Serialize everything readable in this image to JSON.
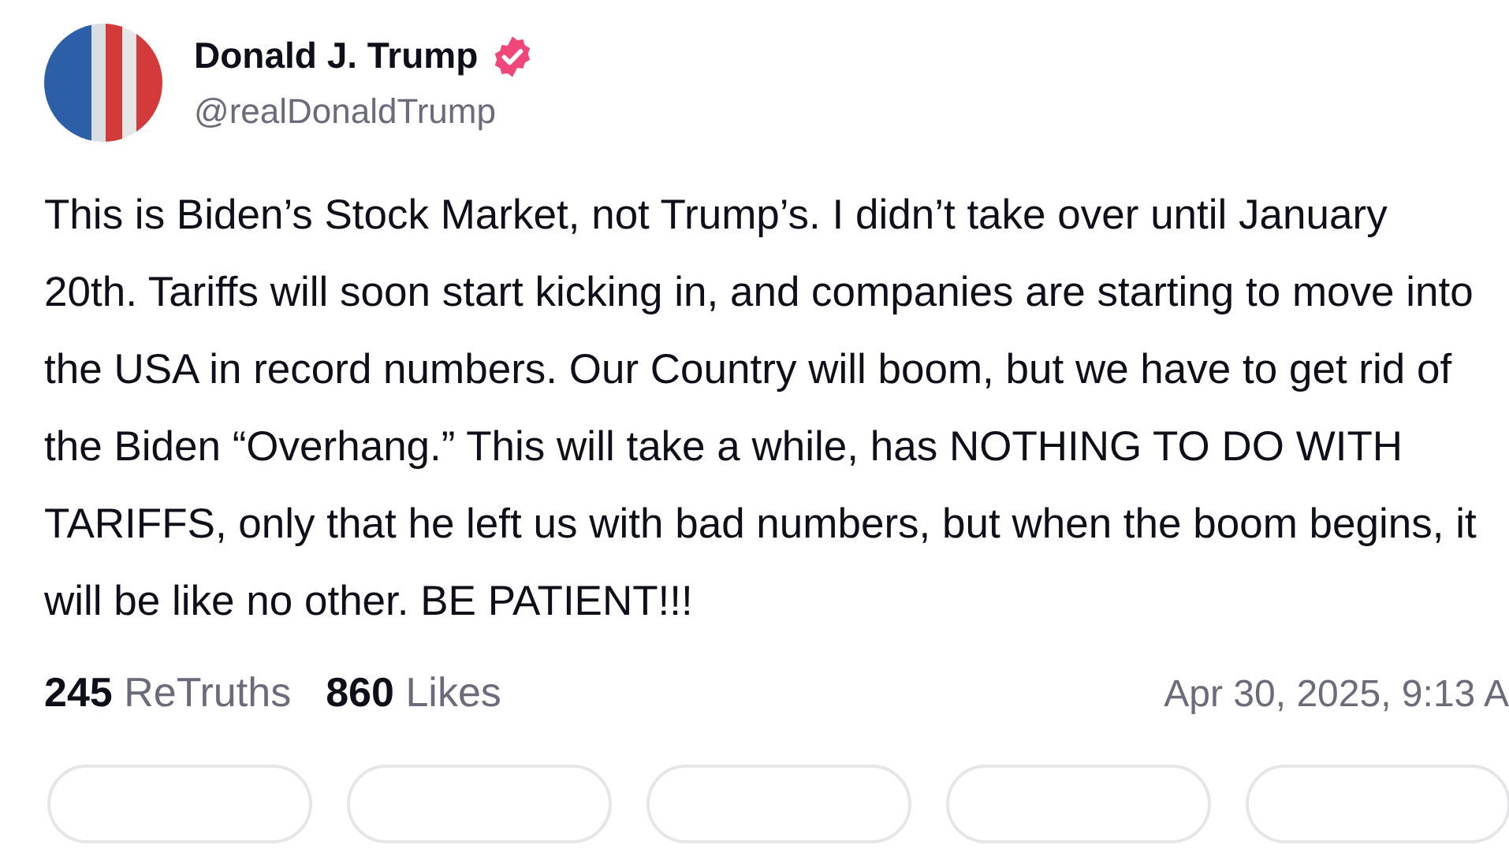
{
  "author": {
    "name": "Donald J. Trump",
    "verified": true,
    "handle": "@realDonaldTrump"
  },
  "post": {
    "text": "This is Biden’s Stock Market, not Trump’s. I didn’t take over until January 20th. Tariffs will soon start kicking in, and companies are starting to move into the USA in record numbers. Our Country will boom, but we have to get rid of the Biden “Overhang.” This will take a while, has NOTHING TO DO WITH TARIFFS, only that he left us with bad numbers, but when the boom begins, it will be like no other. BE PATIENT!!!"
  },
  "stats": [
    {
      "count": "245",
      "label": "ReTruths"
    },
    {
      "count": "860",
      "label": "Likes"
    }
  ],
  "timestamp": "Apr 30, 2025, 9:13 A"
}
